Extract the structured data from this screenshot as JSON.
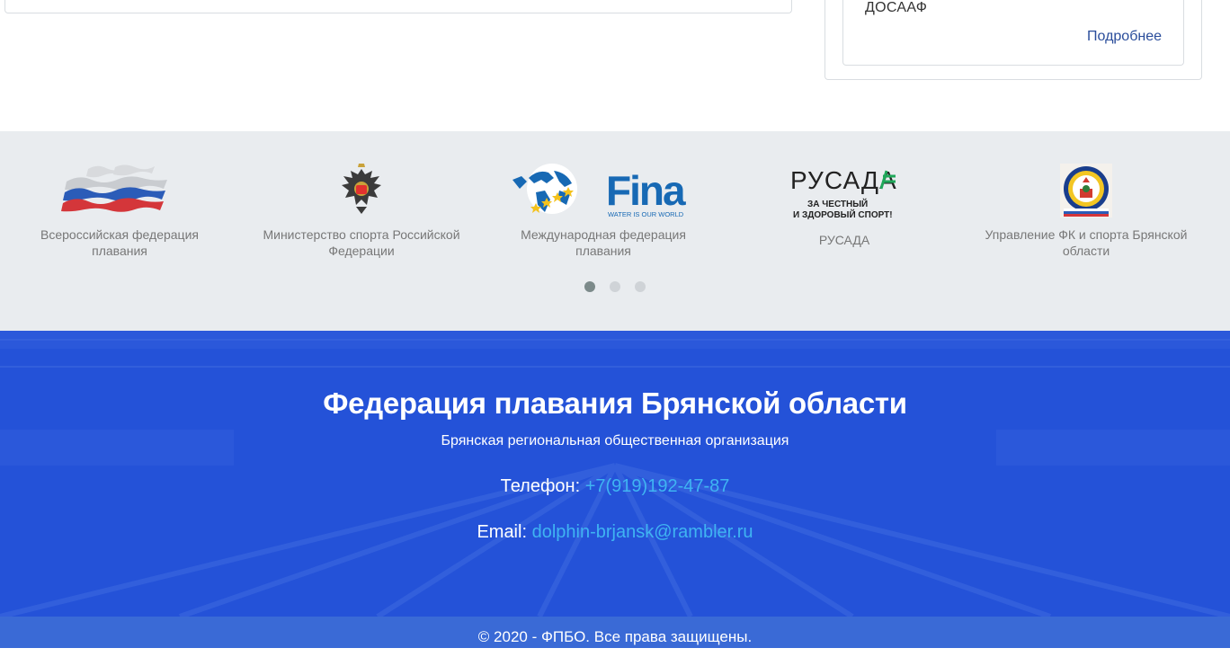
{
  "top": {
    "card_title": "ДОСААФ",
    "more_label": "Подробнее"
  },
  "partners": [
    {
      "name": "Всероссийская федерация плавания",
      "icon": "swimming-federation-flags-logo"
    },
    {
      "name": "Министерство спорта Российской Федерации",
      "icon": "double-headed-eagle-emblem"
    },
    {
      "name": "Международная федерация плавания",
      "icon": "fina-logo",
      "logo_text": "Fina",
      "logo_tagline": "WATER IS OUR WORLD"
    },
    {
      "name": "РУСАДА",
      "icon": "rusada-logo",
      "logo_text": "РУСАДА",
      "logo_tagline_1": "ЗА ЧЕСТНЫЙ",
      "logo_tagline_2": "И ЗДОРОВЫЙ СПОРТ!"
    },
    {
      "name": "Управление ФК и спорта Брянской области",
      "icon": "bryansk-sport-emblem"
    }
  ],
  "carousel": {
    "pages": 3,
    "active": 1
  },
  "footer": {
    "title": "Федерация плавания Брянской области",
    "subtitle": "Брянская региональная общественная организация",
    "phone_label": "Телефон:",
    "phone": "+7(919)192-47-87",
    "email_label": "Email:",
    "email": "dolphin-brjansk@rambler.ru",
    "copyright": "© 2020 - ФПБО. Все права защищены."
  },
  "colors": {
    "footer_bg": "#2452d8",
    "link": "#3fb4f2",
    "partners_bg": "#e9ecef"
  }
}
